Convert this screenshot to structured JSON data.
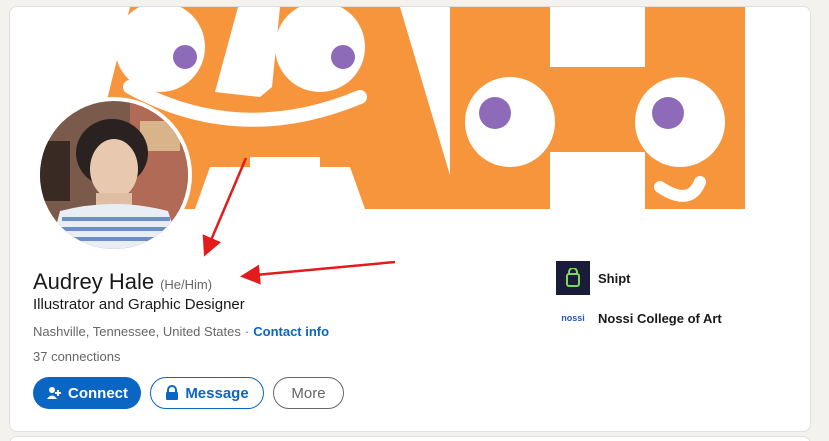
{
  "profile": {
    "name": "Audrey Hale",
    "pronouns": "(He/Him)",
    "headline": "Illustrator and Graphic Designer",
    "location": "Nashville, Tennessee, United States",
    "separator": "·",
    "contact_info": "Contact info",
    "connections": "37 connections"
  },
  "actions": {
    "connect": "Connect",
    "message": "Message",
    "more": "More"
  },
  "organizations": [
    {
      "name": "Shipt",
      "logo": "shipt-logo"
    },
    {
      "name": "Nossi College of Art",
      "logo": "nossi-logo",
      "logo_text": "nossi"
    }
  ],
  "colors": {
    "banner_orange": "#f7953d",
    "banner_purple": "#8e6bb8",
    "primary_blue": "#0a66c2",
    "annotation_red": "#e31b1b",
    "shipt_bg": "#1b1b3a",
    "shipt_green": "#7ed957"
  }
}
